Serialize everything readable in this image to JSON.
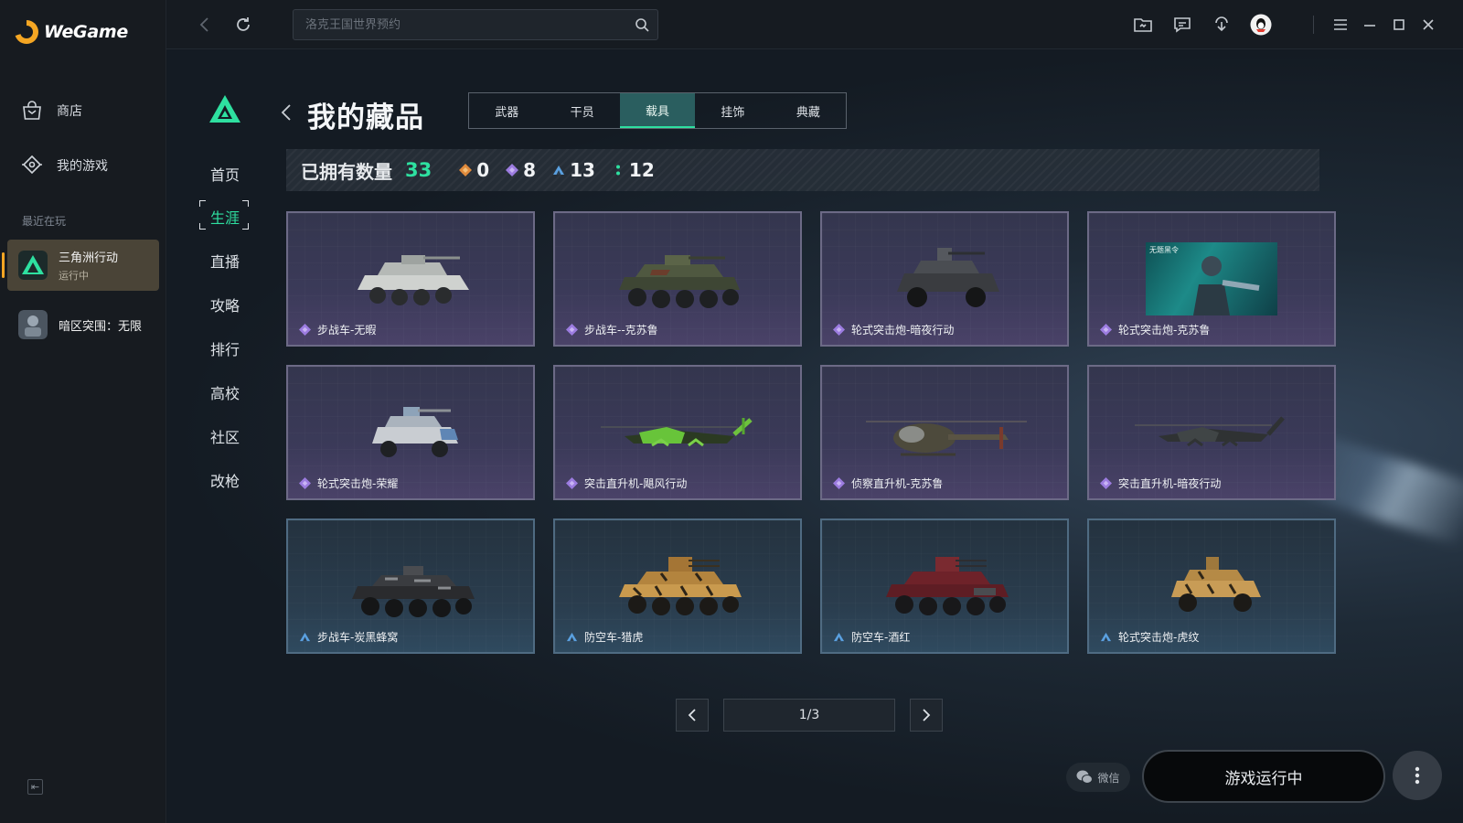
{
  "brand": {
    "name": "WeGame"
  },
  "sidebar": {
    "nav": [
      {
        "label": "商店",
        "icon": "shopping-bag-icon"
      },
      {
        "label": "我的游戏",
        "icon": "game-tag-icon"
      }
    ],
    "recent_label": "最近在玩",
    "recent_games": [
      {
        "title": "三角洲行动",
        "status": "运行中",
        "active": true
      },
      {
        "title": "暗区突围：无限",
        "status": ""
      }
    ]
  },
  "topbar": {
    "search_placeholder": "洛克王国世界预约",
    "icons": [
      "back-arrow-icon",
      "refresh-icon",
      "search-icon",
      "folder-icon",
      "message-icon",
      "download-icon",
      "qq-avatar-icon",
      "menu-icon",
      "minimize-icon",
      "maximize-icon",
      "close-icon"
    ]
  },
  "game_nav": {
    "items": [
      "首页",
      "生涯",
      "直播",
      "攻略",
      "排行",
      "高校",
      "社区",
      "改枪"
    ],
    "active": "生涯"
  },
  "page": {
    "title": "我的藏品",
    "tabs": [
      "武器",
      "干员",
      "载具",
      "挂饰",
      "典藏"
    ],
    "active_tab": "载具"
  },
  "stats": {
    "label": "已拥有数量",
    "total": "33",
    "rarities": [
      {
        "name": "gold",
        "color": "#e08a3c",
        "count": "0"
      },
      {
        "name": "purple",
        "color": "#9c7ce0",
        "count": "8"
      },
      {
        "name": "blue",
        "color": "#5aa0e0",
        "count": "13"
      },
      {
        "name": "green",
        "color": "#2ee0a0",
        "count": "12"
      }
    ]
  },
  "items": [
    {
      "name": "步战车-无暇",
      "rarity": "purple",
      "kind": "ifv-white"
    },
    {
      "name": "步战车--克苏鲁",
      "rarity": "purple",
      "kind": "ifv-camo"
    },
    {
      "name": "轮式突击炮-暗夜行动",
      "rarity": "purple",
      "kind": "assault-dark"
    },
    {
      "name": "轮式突击炮-克苏鲁",
      "rarity": "purple",
      "kind": "poster",
      "poster_title": "无题黑令"
    },
    {
      "name": "轮式突击炮-荣耀",
      "rarity": "purple",
      "kind": "assault-white"
    },
    {
      "name": "突击直升机-飓风行动",
      "rarity": "purple",
      "kind": "heli-green"
    },
    {
      "name": "侦察直升机-克苏鲁",
      "rarity": "purple",
      "kind": "heli-scout"
    },
    {
      "name": "突击直升机-暗夜行动",
      "rarity": "purple",
      "kind": "heli-dark"
    },
    {
      "name": "步战车-炭黑蜂窝",
      "rarity": "blue",
      "kind": "ifv-black"
    },
    {
      "name": "防空车-猎虎",
      "rarity": "blue",
      "kind": "aa-tiger"
    },
    {
      "name": "防空车-酒红",
      "rarity": "blue",
      "kind": "aa-red"
    },
    {
      "name": "轮式突击炮-虎纹",
      "rarity": "blue",
      "kind": "assault-tiger"
    }
  ],
  "pagination": {
    "text": "1/3"
  },
  "footer": {
    "wechat_label": "微信",
    "run_label": "游戏运行中"
  }
}
